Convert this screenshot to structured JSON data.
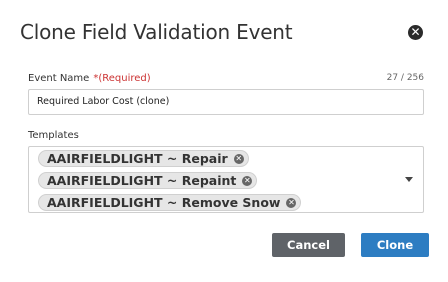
{
  "dialog": {
    "title": "Clone Field Validation Event",
    "close_icon": "close-icon",
    "close_glyph": "✕"
  },
  "event_name": {
    "label": "Event Name",
    "required_text": "*(Required)",
    "counter": "27 / 256",
    "value": "Required Labor Cost (clone)"
  },
  "templates": {
    "label": "Templates",
    "chips": [
      {
        "label": "AAIRFIELDLIGHT ~ Repair"
      },
      {
        "label": "AAIRFIELDLIGHT ~ Repaint"
      },
      {
        "label": "AAIRFIELDLIGHT ~ Remove Snow"
      }
    ],
    "chip_remove_glyph": "✕",
    "dropdown_icon": "caret-down-icon"
  },
  "buttons": {
    "cancel": "Cancel",
    "clone": "Clone"
  },
  "colors": {
    "cancel_bg": "#5f6368",
    "clone_bg": "#2d7dc2",
    "required": "#cc3333"
  }
}
